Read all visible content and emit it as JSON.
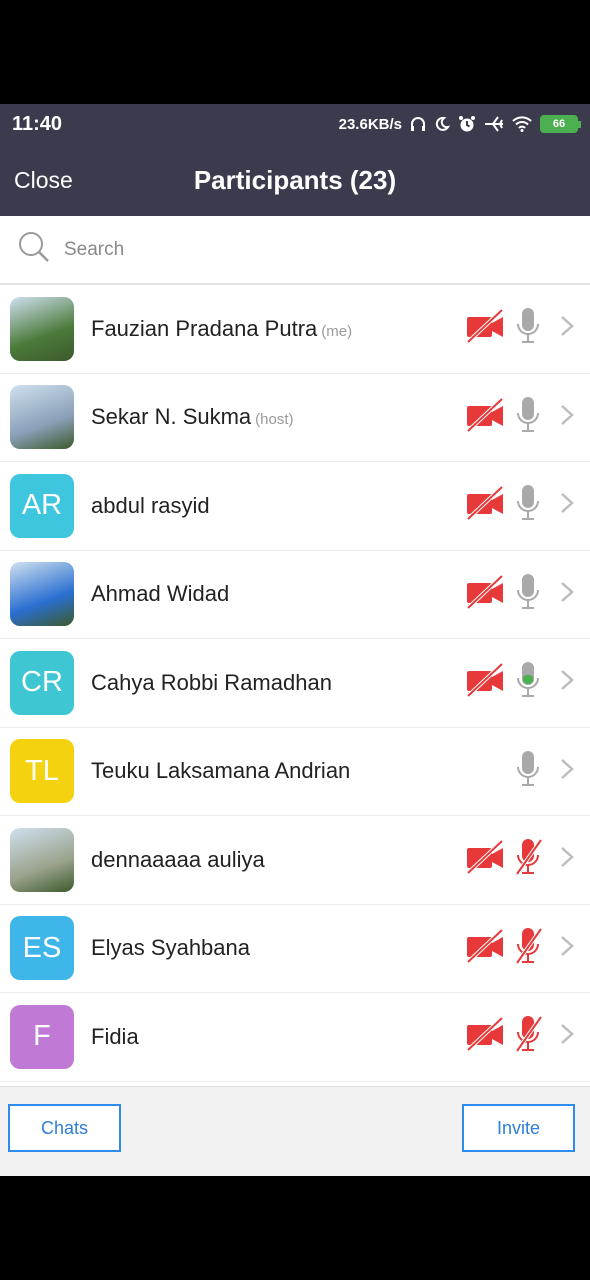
{
  "status": {
    "time": "11:40",
    "net_speed": "23.6KB/s",
    "battery": "66"
  },
  "nav": {
    "close": "Close",
    "title": "Participants (23)"
  },
  "search": {
    "placeholder": "Search"
  },
  "participants": [
    {
      "name": "Fauzian Pradana Putra",
      "role": "(me)",
      "initials": "",
      "color": "#4a7a3a",
      "video_off": true,
      "mic": "idle"
    },
    {
      "name": "Sekar N. Sukma",
      "role": "(host)",
      "initials": "",
      "color": "#8aa0b8",
      "video_off": true,
      "mic": "idle"
    },
    {
      "name": "abdul rasyid",
      "role": "",
      "initials": "AR",
      "color": "#3ec6de",
      "video_off": true,
      "mic": "idle"
    },
    {
      "name": "Ahmad Widad",
      "role": "",
      "initials": "",
      "color": "#2a6fd1",
      "video_off": true,
      "mic": "idle"
    },
    {
      "name": "Cahya Robbi Ramadhan",
      "role": "",
      "initials": "CR",
      "color": "#3ec6d2",
      "video_off": true,
      "mic": "active"
    },
    {
      "name": "Teuku Laksamana Andrian",
      "role": "",
      "initials": "TL",
      "color": "#f5d20f",
      "video_off": false,
      "mic": "idle"
    },
    {
      "name": "dennaaaaa auliya",
      "role": "",
      "initials": "",
      "color": "#9aa38c",
      "video_off": true,
      "mic": "muted"
    },
    {
      "name": "Elyas Syahbana",
      "role": "",
      "initials": "ES",
      "color": "#3eb6ea",
      "video_off": true,
      "mic": "muted"
    },
    {
      "name": "Fidia",
      "role": "",
      "initials": "F",
      "color": "#c07ad6",
      "video_off": true,
      "mic": "muted"
    }
  ],
  "footer": {
    "chats": "Chats",
    "invite": "Invite"
  }
}
